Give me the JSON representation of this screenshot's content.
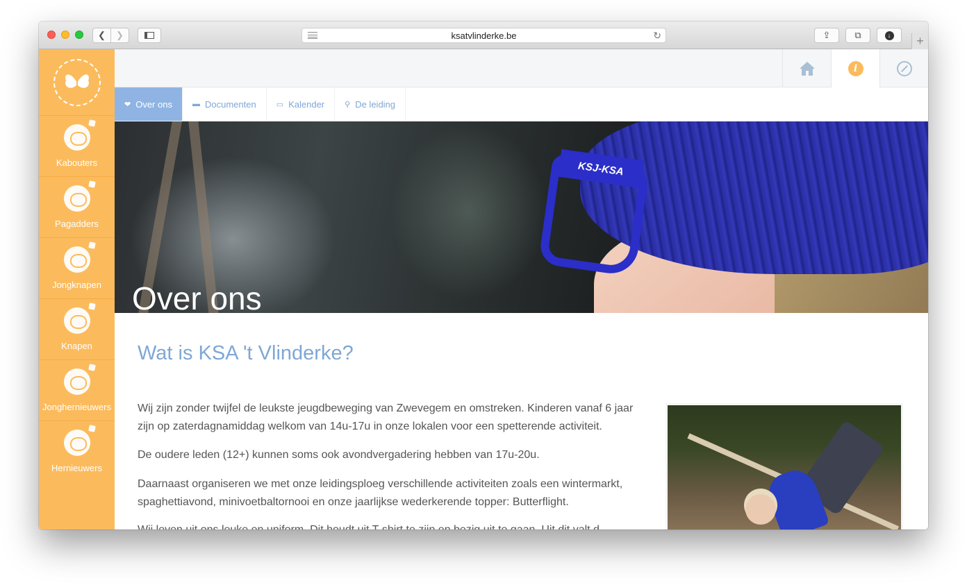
{
  "browser": {
    "url": "ksatvlinderke.be",
    "icons": {
      "back": "chevron-left-icon",
      "forward": "chevron-right-icon",
      "sidebar": "sidebar-icon",
      "reader": "reader-icon",
      "reload": "reload-icon",
      "share": "share-icon",
      "tabs": "tabs-icon",
      "downloads": "download-icon",
      "new_tab": "plus-icon"
    }
  },
  "sidebar": {
    "logo": "butterfly-logo",
    "items": [
      {
        "label": "Kabouters"
      },
      {
        "label": "Pagadders"
      },
      {
        "label": "Jongknapen"
      },
      {
        "label": "Knapen"
      },
      {
        "label": "Jonghernieuwers"
      },
      {
        "label": "Hernieuwers"
      }
    ]
  },
  "topbar": {
    "icons": [
      "home-icon",
      "info-icon",
      "compass-icon"
    ],
    "active": "info-icon",
    "info_glyph": "i"
  },
  "subnav": {
    "items": [
      {
        "label": "Over ons",
        "icon": "heart-icon",
        "glyph": "❤",
        "active": true
      },
      {
        "label": "Documenten",
        "icon": "briefcase-icon",
        "glyph": "▬",
        "active": false
      },
      {
        "label": "Kalender",
        "icon": "calendar-icon",
        "glyph": "▭",
        "active": false
      },
      {
        "label": "De leiding",
        "icon": "pin-icon",
        "glyph": "⚲",
        "active": false
      }
    ]
  },
  "hero": {
    "title": "Over ons",
    "glasses_text": "KSJ-KSA"
  },
  "content": {
    "heading": "Wat is KSA 't Vlinderke?",
    "paragraphs": [
      "Wij zijn zonder twijfel de leukste jeugdbeweging van Zwevegem en omstreken. Kinderen vanaf 6 jaar zijn op zaterdagnamiddag welkom van 14u-17u in onze lokalen voor een spetterende activiteit.",
      "De oudere leden (12+) kunnen soms ook avondvergadering hebben van 17u-20u.",
      "Daarnaast organiseren we met onze leidingsploeg verschillende activiteiten zoals een wintermarkt, spaghettiavond, minivoetbaltornooi en onze jaarlijkse wederkerende topper: Butterflight.",
      "Wij leven uit ons leuke en uniform. Dit houdt uit T-shirt te zijn en bezig uit te gaan. Uit dit valt d..."
    ],
    "photo": "child-on-rope-photo"
  },
  "colors": {
    "sidebar": "#fbbb5d",
    "accent_blue": "#7fa7d6",
    "active_tab": "#8fb4e3",
    "info_icon": "#fbbb5d"
  }
}
